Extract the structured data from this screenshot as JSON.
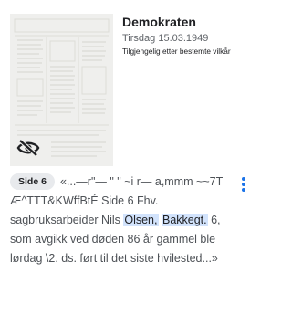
{
  "result": {
    "title": "Demokraten",
    "date": "Tirsdag 15.03.1949",
    "access": "Tilgjengelig etter bestemte vilkår",
    "thumbnail_icon": "eye-slash-icon",
    "page_chip": "Side 6",
    "snippet_text_1": "«...—r\"— \" \" ~i r— a,mmm ~~7T Æ^TTT&KWffBtÉ Side 6 Fhv. sagbruksarbeider Nils ",
    "snippet_highlight_1": "Olsen,",
    "snippet_text_2": " ",
    "snippet_highlight_2": "Bakkegt.",
    "snippet_text_3": " 6, som avgikk ved døden 86 år gammel ble lørdag \\2. ds. ført til det siste hvilested...»",
    "more_icon": "more-vertical-icon"
  },
  "colors": {
    "accent": "#1a73e8",
    "highlight": "#d2e3fc",
    "chip": "#e8eaed",
    "thumbnail_bg": "#efefed"
  }
}
